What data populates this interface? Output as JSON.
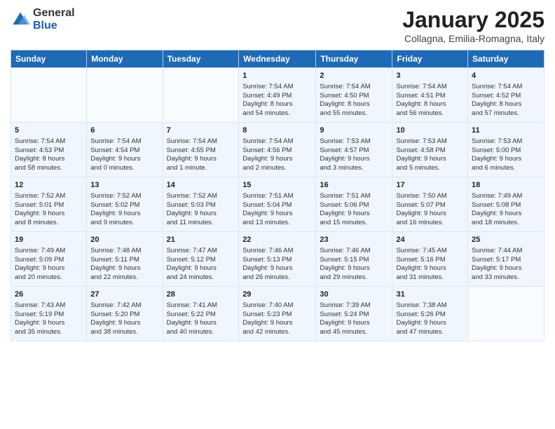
{
  "logo": {
    "general": "General",
    "blue": "Blue"
  },
  "title": "January 2025",
  "subtitle": "Collagna, Emilia-Romagna, Italy",
  "headers": [
    "Sunday",
    "Monday",
    "Tuesday",
    "Wednesday",
    "Thursday",
    "Friday",
    "Saturday"
  ],
  "weeks": [
    [
      {
        "day": "",
        "content": ""
      },
      {
        "day": "",
        "content": ""
      },
      {
        "day": "",
        "content": ""
      },
      {
        "day": "1",
        "content": "Sunrise: 7:54 AM\nSunset: 4:49 PM\nDaylight: 8 hours\nand 54 minutes."
      },
      {
        "day": "2",
        "content": "Sunrise: 7:54 AM\nSunset: 4:50 PM\nDaylight: 8 hours\nand 55 minutes."
      },
      {
        "day": "3",
        "content": "Sunrise: 7:54 AM\nSunset: 4:51 PM\nDaylight: 8 hours\nand 56 minutes."
      },
      {
        "day": "4",
        "content": "Sunrise: 7:54 AM\nSunset: 4:52 PM\nDaylight: 8 hours\nand 57 minutes."
      }
    ],
    [
      {
        "day": "5",
        "content": "Sunrise: 7:54 AM\nSunset: 4:53 PM\nDaylight: 8 hours\nand 58 minutes."
      },
      {
        "day": "6",
        "content": "Sunrise: 7:54 AM\nSunset: 4:54 PM\nDaylight: 9 hours\nand 0 minutes."
      },
      {
        "day": "7",
        "content": "Sunrise: 7:54 AM\nSunset: 4:55 PM\nDaylight: 9 hours\nand 1 minute."
      },
      {
        "day": "8",
        "content": "Sunrise: 7:54 AM\nSunset: 4:56 PM\nDaylight: 9 hours\nand 2 minutes."
      },
      {
        "day": "9",
        "content": "Sunrise: 7:53 AM\nSunset: 4:57 PM\nDaylight: 9 hours\nand 3 minutes."
      },
      {
        "day": "10",
        "content": "Sunrise: 7:53 AM\nSunset: 4:58 PM\nDaylight: 9 hours\nand 5 minutes."
      },
      {
        "day": "11",
        "content": "Sunrise: 7:53 AM\nSunset: 5:00 PM\nDaylight: 9 hours\nand 6 minutes."
      }
    ],
    [
      {
        "day": "12",
        "content": "Sunrise: 7:52 AM\nSunset: 5:01 PM\nDaylight: 9 hours\nand 8 minutes."
      },
      {
        "day": "13",
        "content": "Sunrise: 7:52 AM\nSunset: 5:02 PM\nDaylight: 9 hours\nand 9 minutes."
      },
      {
        "day": "14",
        "content": "Sunrise: 7:52 AM\nSunset: 5:03 PM\nDaylight: 9 hours\nand 11 minutes."
      },
      {
        "day": "15",
        "content": "Sunrise: 7:51 AM\nSunset: 5:04 PM\nDaylight: 9 hours\nand 13 minutes."
      },
      {
        "day": "16",
        "content": "Sunrise: 7:51 AM\nSunset: 5:06 PM\nDaylight: 9 hours\nand 15 minutes."
      },
      {
        "day": "17",
        "content": "Sunrise: 7:50 AM\nSunset: 5:07 PM\nDaylight: 9 hours\nand 16 minutes."
      },
      {
        "day": "18",
        "content": "Sunrise: 7:49 AM\nSunset: 5:08 PM\nDaylight: 9 hours\nand 18 minutes."
      }
    ],
    [
      {
        "day": "19",
        "content": "Sunrise: 7:49 AM\nSunset: 5:09 PM\nDaylight: 9 hours\nand 20 minutes."
      },
      {
        "day": "20",
        "content": "Sunrise: 7:48 AM\nSunset: 5:11 PM\nDaylight: 9 hours\nand 22 minutes."
      },
      {
        "day": "21",
        "content": "Sunrise: 7:47 AM\nSunset: 5:12 PM\nDaylight: 9 hours\nand 24 minutes."
      },
      {
        "day": "22",
        "content": "Sunrise: 7:46 AM\nSunset: 5:13 PM\nDaylight: 9 hours\nand 26 minutes."
      },
      {
        "day": "23",
        "content": "Sunrise: 7:46 AM\nSunset: 5:15 PM\nDaylight: 9 hours\nand 29 minutes."
      },
      {
        "day": "24",
        "content": "Sunrise: 7:45 AM\nSunset: 5:16 PM\nDaylight: 9 hours\nand 31 minutes."
      },
      {
        "day": "25",
        "content": "Sunrise: 7:44 AM\nSunset: 5:17 PM\nDaylight: 9 hours\nand 33 minutes."
      }
    ],
    [
      {
        "day": "26",
        "content": "Sunrise: 7:43 AM\nSunset: 5:19 PM\nDaylight: 9 hours\nand 35 minutes."
      },
      {
        "day": "27",
        "content": "Sunrise: 7:42 AM\nSunset: 5:20 PM\nDaylight: 9 hours\nand 38 minutes."
      },
      {
        "day": "28",
        "content": "Sunrise: 7:41 AM\nSunset: 5:22 PM\nDaylight: 9 hours\nand 40 minutes."
      },
      {
        "day": "29",
        "content": "Sunrise: 7:40 AM\nSunset: 5:23 PM\nDaylight: 9 hours\nand 42 minutes."
      },
      {
        "day": "30",
        "content": "Sunrise: 7:39 AM\nSunset: 5:24 PM\nDaylight: 9 hours\nand 45 minutes."
      },
      {
        "day": "31",
        "content": "Sunrise: 7:38 AM\nSunset: 5:26 PM\nDaylight: 9 hours\nand 47 minutes."
      },
      {
        "day": "",
        "content": ""
      }
    ]
  ]
}
